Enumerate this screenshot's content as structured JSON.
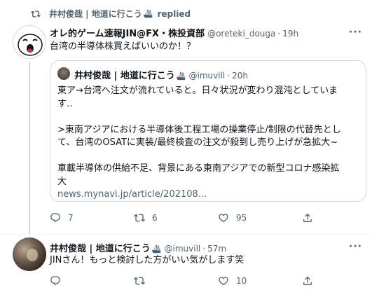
{
  "social_context": {
    "name": "井村俊哉 | 地道に行こう",
    "emoji": "🚢",
    "action": "replied"
  },
  "tweet": {
    "name": "オレ的ゲーム速報JIN@FX・株投資部",
    "handle": "@oreteki_douga",
    "separator": "·",
    "time": "19h",
    "text": "台湾の半導体株買えばいいのか！？",
    "quote": {
      "name": "井村俊哉 | 地道に行こう",
      "emoji": "🚢",
      "handle": "@imuvill",
      "separator": "·",
      "time": "20h",
      "lines": [
        "東ア→台湾へ注文が流れていると。日々状況が変わり混沌としていま",
        "す‥",
        "",
        ">東南アジアにおける半導体後工程工場の操業停止/制限の代替先とし",
        "て、台湾のOSATに実装/最終検査の注文が殺到し売り上げが急拡大~",
        "",
        "車載半導体の供給不足、背景にある東南アジアでの新型コロナ感染拡",
        "大"
      ],
      "link": "news.mynavi.jp/article/202108..."
    },
    "actions": {
      "reply_count": "7",
      "retweet_count": "6",
      "like_count": "95",
      "icons": [
        "reply-icon",
        "retweet-icon",
        "like-icon",
        "share-icon"
      ]
    }
  },
  "reply": {
    "name": "井村俊哉 | 地道に行こう",
    "emoji": "🚢",
    "handle": "@imuvill",
    "separator": "·",
    "time": "57m",
    "text": "JINさん！もっと検討した方がいい気がします笑",
    "actions": {
      "reply_count": "",
      "retweet_count": "",
      "like_count": "10"
    }
  },
  "colors": {
    "text": "#0f1419",
    "secondary": "#536471",
    "border": "#cfd9de",
    "divider": "#eff3f4"
  }
}
